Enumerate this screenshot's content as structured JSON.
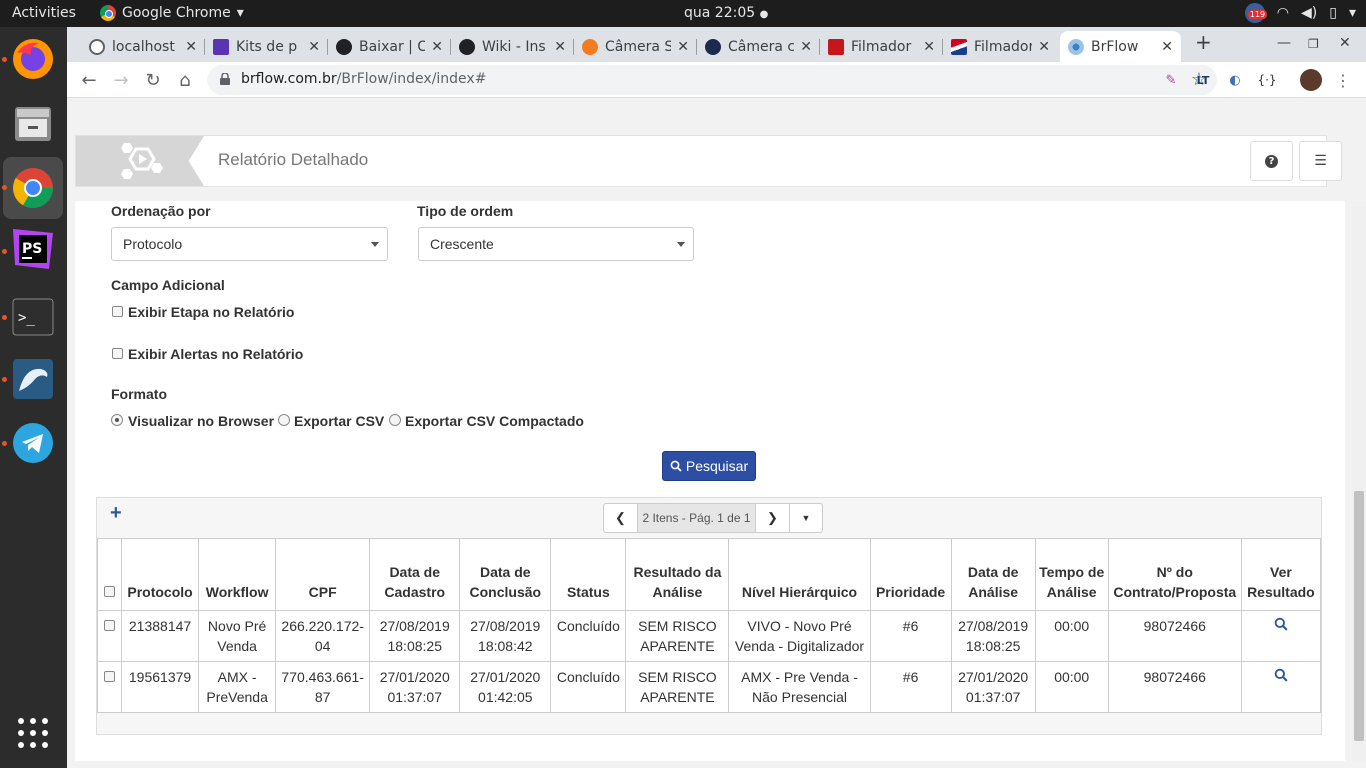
{
  "topbar": {
    "activities": "Activities",
    "app_name": "Google Chrome",
    "clock": "qua 22:05",
    "notif_count": "119"
  },
  "browser": {
    "tabs": [
      {
        "label": "localhost",
        "color": "#5f6368"
      },
      {
        "label": "Kits de p",
        "color": "#5b34b5"
      },
      {
        "label": "Baixar | C",
        "color": "#202124"
      },
      {
        "label": "Wiki - Ins",
        "color": "#202124"
      },
      {
        "label": "Câmera S",
        "color": "#f47c20"
      },
      {
        "label": "Câmera c",
        "color": "#1d2a4d"
      },
      {
        "label": "Filmador",
        "color": "#c4161c"
      },
      {
        "label": "Filmador",
        "color": "#d6001c"
      },
      {
        "label": "BrFlow",
        "color": "#3b82c4"
      }
    ],
    "url_domain": "brflow.com.br",
    "url_path": "/BrFlow/index/index#"
  },
  "header": {
    "title": "Relatório Detalhado"
  },
  "form": {
    "order_by_label": "Ordenação por",
    "order_by_value": "Protocolo",
    "order_type_label": "Tipo de ordem",
    "order_type_value": "Crescente",
    "extra_field_label": "Campo Adicional",
    "show_stage": "Exibir Etapa no Relatório",
    "show_alerts": "Exibir Alertas no Relatório",
    "format_label": "Formato",
    "format_browser": "Visualizar no Browser",
    "format_csv": "Exportar CSV",
    "format_csv_compact": "Exportar CSV Compactado",
    "search_button": "Pesquisar"
  },
  "grid": {
    "pager_info": "2 Itens - Pág. 1 de 1",
    "headers": {
      "protocolo": "Protocolo",
      "workflow": "Workflow",
      "cpf": "CPF",
      "data_cadastro": "Data de Cadastro",
      "data_conclusao": "Data de Conclusão",
      "status": "Status",
      "resultado": "Resultado da Análise",
      "nivel": "Nível Hierárquico",
      "prioridade": "Prioridade",
      "data_analise": "Data de Análise",
      "tempo": "Tempo de Análise",
      "contrato": "Nº do Contrato/Proposta",
      "ver": "Ver Resultado"
    },
    "rows": [
      {
        "protocolo": "21388147",
        "workflow": "Novo Pré Venda",
        "cpf": "266.220.172-04",
        "data_cadastro": "27/08/2019 18:08:25",
        "data_conclusao": "27/08/2019 18:08:42",
        "status": "Concluído",
        "resultado": "SEM RISCO APARENTE",
        "nivel": "VIVO - Novo Pré Venda - Digitalizador",
        "prioridade": "#6",
        "data_analise": "27/08/2019 18:08:25",
        "tempo": "00:00",
        "contrato": "98072466"
      },
      {
        "protocolo": "19561379",
        "workflow": "AMX - PreVenda",
        "cpf": "770.463.661-87",
        "data_cadastro": "27/01/2020 01:37:07",
        "data_conclusao": "27/01/2020 01:42:05",
        "status": "Concluído",
        "resultado": "SEM RISCO APARENTE",
        "nivel": "AMX - Pre Venda - Não Presencial",
        "prioridade": "#6",
        "data_analise": "27/01/2020 01:37:07",
        "tempo": "00:00",
        "contrato": "98072466"
      }
    ]
  }
}
